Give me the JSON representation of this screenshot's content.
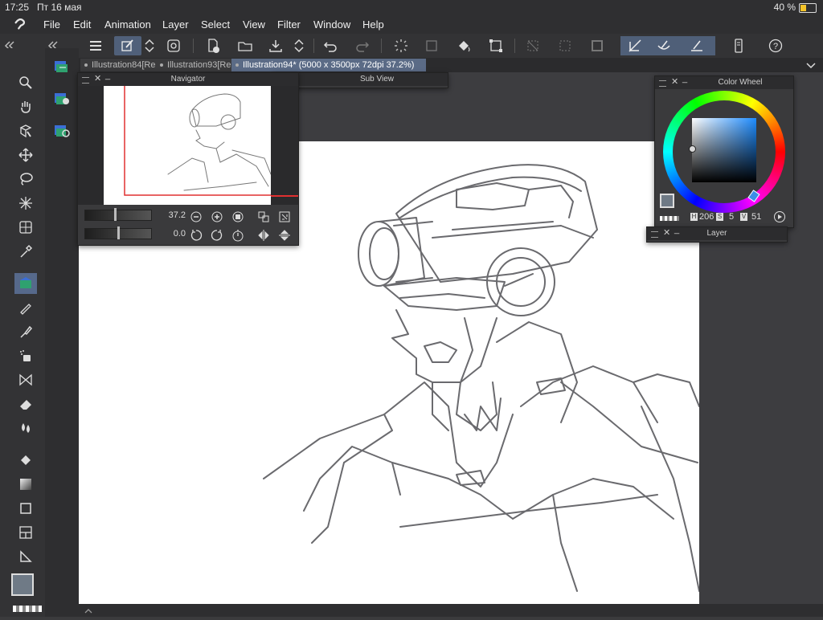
{
  "status": {
    "time": "17:25",
    "date": "Пт 16 мая",
    "battery": "40 %"
  },
  "menu": [
    "File",
    "Edit",
    "Animation",
    "Layer",
    "Select",
    "View",
    "Filter",
    "Window",
    "Help"
  ],
  "tabs": [
    {
      "label": "Illustration84[Re"
    },
    {
      "label": "Illustration93[Re"
    },
    {
      "label": "Illustration94* (5000 x 3500px 72dpi 37.2%)"
    }
  ],
  "navigator": {
    "title": "Navigator",
    "zoom": "37.2",
    "rotation": "0.0",
    "zoom_slider_level": 0.45,
    "rotation_slider_level": 0.5
  },
  "subview": {
    "title": "Sub View"
  },
  "color_wheel": {
    "title": "Color Wheel",
    "h_label": "H",
    "h_value": "206",
    "s_label": "S",
    "s_value": "5",
    "v_label": "V",
    "v_value": "51",
    "main_color": "#6f7a86",
    "sub_color": "#8c7aa6"
  },
  "layer_panel": {
    "title": "Layer"
  },
  "colors": {
    "accent": "#56698b",
    "tab_active": "#5b6b86",
    "nav_frame": "#e03030"
  }
}
